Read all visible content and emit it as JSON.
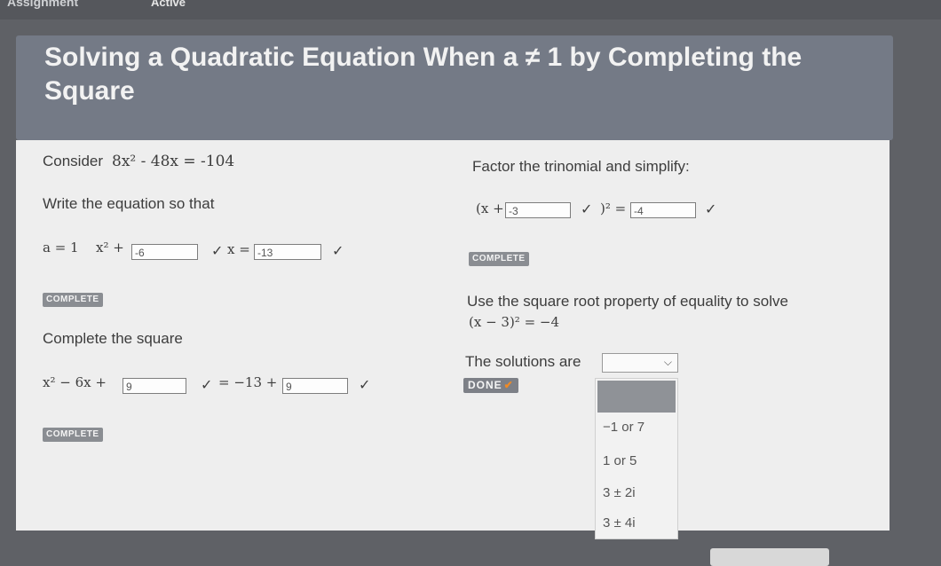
{
  "topbar": {
    "crumb": "Assignment",
    "status": "Active"
  },
  "header": {
    "title": "Solving a Quadratic Equation When a ≠ 1 by Completing the Square"
  },
  "left": {
    "consider_label": "Consider",
    "equation": "8x² - 48x = -104",
    "write_label": "Write the equation so that",
    "a_eq": "a = 1",
    "x2_plus": "x² +",
    "input_b": "-6",
    "x_eq": "x =",
    "input_c": "-13",
    "complete_btn_1": "COMPLETE",
    "complete_square_label": "Complete the square",
    "square_lhs": "x² − 6x +",
    "input_sq1": "9",
    "square_rhs": "= −13 +",
    "input_sq2": "9",
    "complete_btn_2": "COMPLETE"
  },
  "right": {
    "factor_label": "Factor the trinomial and simplify:",
    "factor_lhs": "(x +",
    "input_f1": "-3",
    "factor_mid": ")² =",
    "input_f2": "-4",
    "complete_btn_3": "COMPLETE",
    "sqrt_label": "Use the square root property of equality to solve",
    "sqrt_eq": "(x − 3)² = −4",
    "solutions_label": "The solutions are",
    "done_btn": "DONE",
    "done_check": "✔",
    "options": [
      "−1 or 7",
      "1 or 5",
      "3 ± 2i",
      "3 ± 4i"
    ]
  },
  "icons": {
    "check": "✓"
  }
}
